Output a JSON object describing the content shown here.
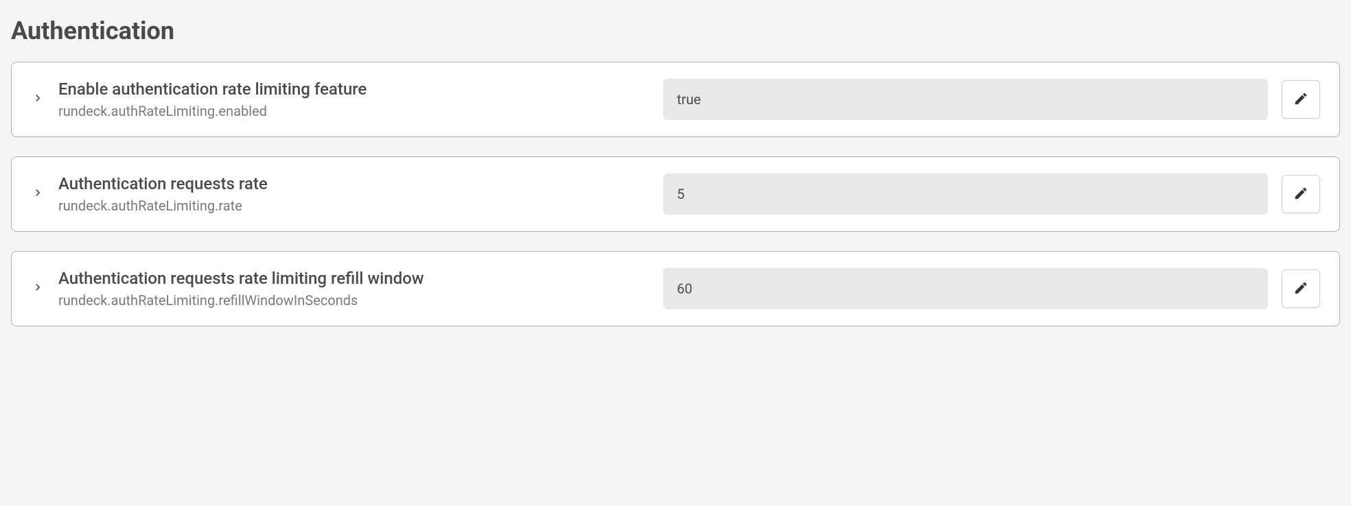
{
  "section": {
    "title": "Authentication"
  },
  "settings": [
    {
      "label": "Enable authentication rate limiting feature",
      "key": "rundeck.authRateLimiting.enabled",
      "value": "true"
    },
    {
      "label": "Authentication requests rate",
      "key": "rundeck.authRateLimiting.rate",
      "value": "5"
    },
    {
      "label": "Authentication requests rate limiting refill window",
      "key": "rundeck.authRateLimiting.refillWindowInSeconds",
      "value": "60"
    }
  ]
}
